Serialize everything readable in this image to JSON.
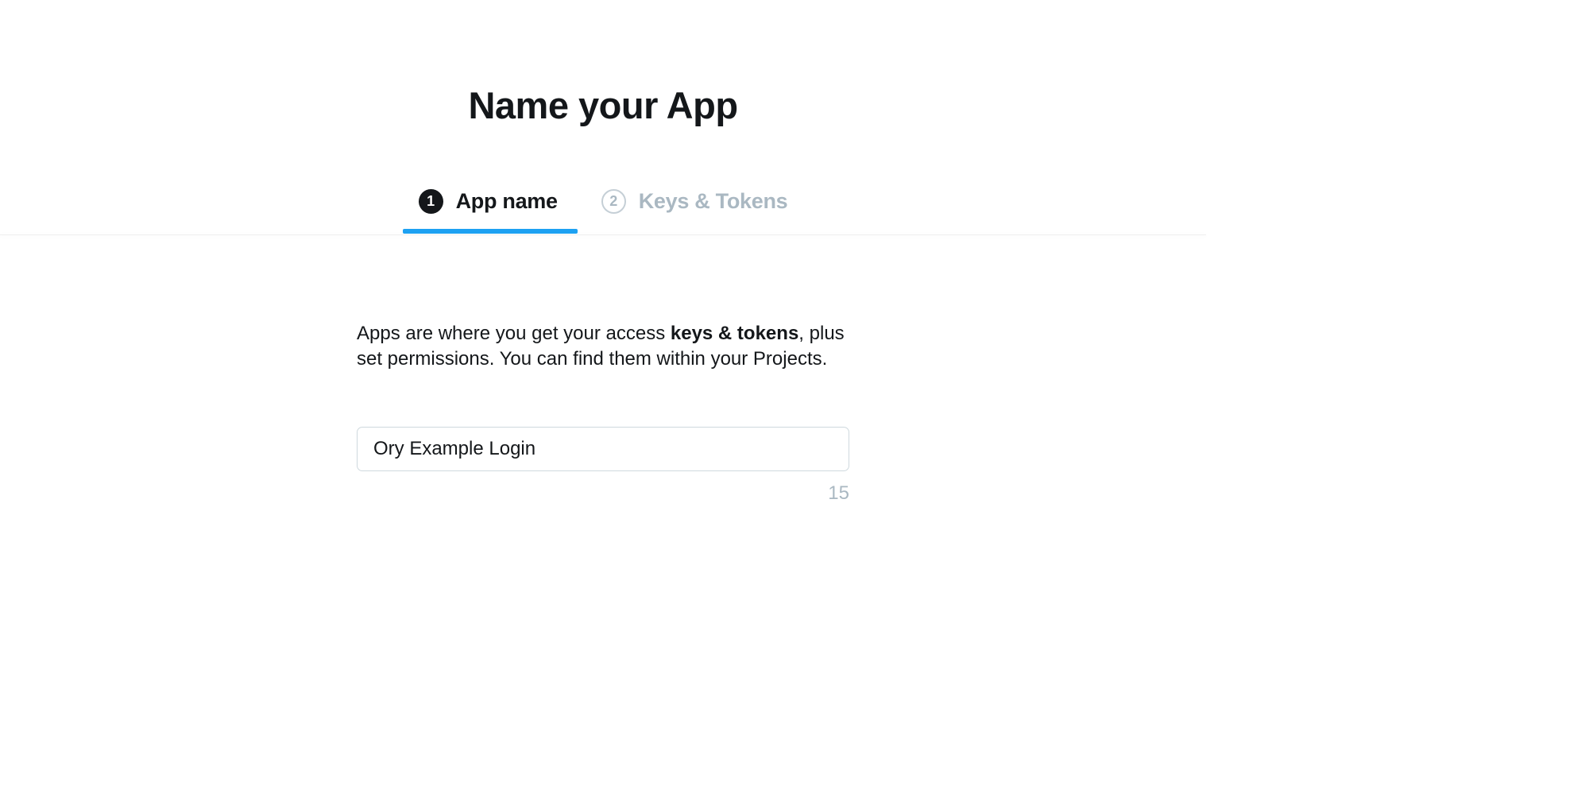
{
  "header": {
    "title": "Name your App"
  },
  "steps": [
    {
      "number": "1",
      "label": "App name",
      "active": true
    },
    {
      "number": "2",
      "label": "Keys & Tokens",
      "active": false
    }
  ],
  "description": {
    "text_before": "Apps are where you get your access ",
    "bold_part": "keys & tokens",
    "text_after": ", plus set permissions. You can find them within your Projects."
  },
  "form": {
    "app_name_value": "Ory Example Login",
    "char_count": "15"
  }
}
